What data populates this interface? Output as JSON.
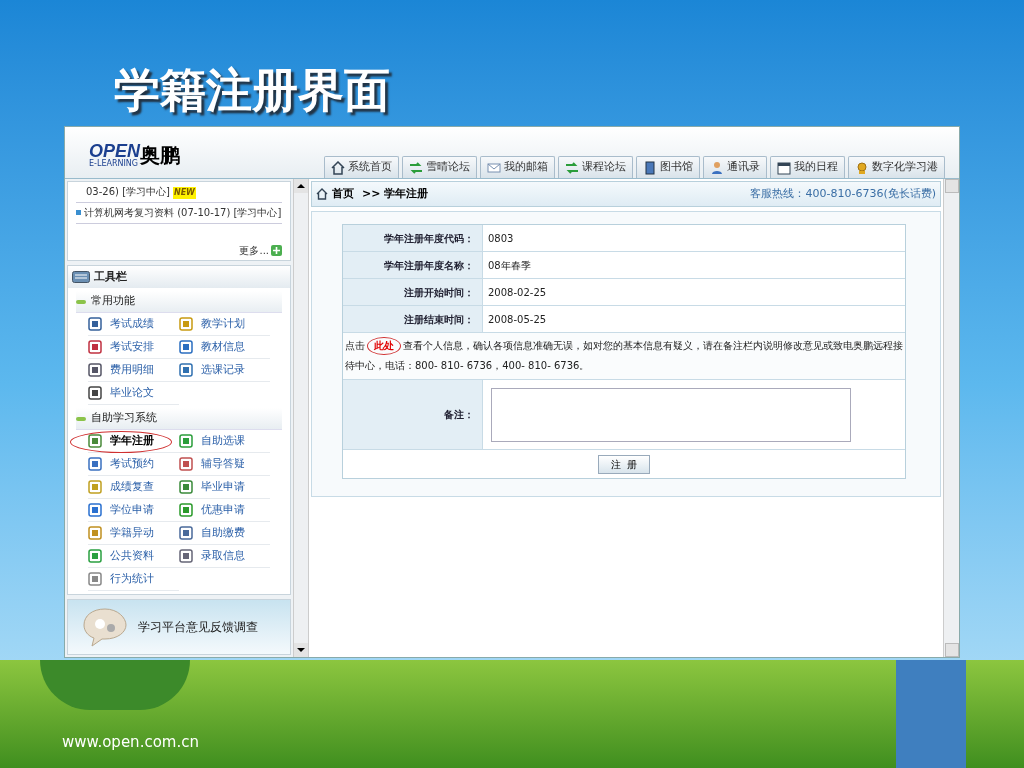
{
  "slide": {
    "title": "学籍注册界面",
    "footer": "www.open.com.cn"
  },
  "window": {
    "logo": {
      "brand": "OPEN",
      "brand_cn": "奥鹏",
      "tagline": "E-LEARNING"
    },
    "tabs": [
      {
        "label": "系统首页",
        "selected": false
      },
      {
        "label": "雪晴论坛",
        "selected": false
      },
      {
        "label": "我的邮箱",
        "selected": false
      },
      {
        "label": "课程论坛",
        "selected": false
      },
      {
        "label": "图书馆",
        "selected": false
      },
      {
        "label": "通讯录",
        "selected": false
      },
      {
        "label": "我的日程",
        "selected": false
      },
      {
        "label": "数字化学习港",
        "selected": false
      }
    ]
  },
  "news": {
    "items": [
      {
        "text": "03-26) [学习中心]",
        "badge": "NEW",
        "bullet": false
      },
      {
        "text": "计算机网考复习资料  (07-10-17) [学习中心]",
        "bullet": true
      }
    ],
    "more": "更多..."
  },
  "toolbar": {
    "title": "工具栏",
    "sections": [
      {
        "title": "常用功能",
        "items": [
          {
            "label": "考试成绩",
            "circled": false
          },
          {
            "label": "教学计划",
            "circled": false
          },
          {
            "label": "考试安排",
            "circled": false
          },
          {
            "label": "教材信息",
            "circled": false
          },
          {
            "label": "费用明细",
            "circled": false
          },
          {
            "label": "选课记录",
            "circled": false
          },
          {
            "label": "毕业论文",
            "circled": false
          }
        ]
      },
      {
        "title": "自助学习系统",
        "items": [
          {
            "label": "学年注册",
            "circled": true
          },
          {
            "label": "自助选课",
            "circled": false
          },
          {
            "label": "考试预约",
            "circled": false
          },
          {
            "label": "辅导答疑",
            "circled": false
          },
          {
            "label": "成绩复查",
            "circled": false
          },
          {
            "label": "毕业申请",
            "circled": false
          },
          {
            "label": "学位申请",
            "circled": false
          },
          {
            "label": "优惠申请",
            "circled": false
          },
          {
            "label": "学籍异动",
            "circled": false
          },
          {
            "label": "自助缴费",
            "circled": false
          },
          {
            "label": "公共资料",
            "circled": false
          },
          {
            "label": "录取信息",
            "circled": false
          },
          {
            "label": "行为统计",
            "circled": false
          }
        ]
      }
    ]
  },
  "feedback": "学习平台意见反馈调查",
  "breadcrumb": {
    "home": "首页",
    "current": ">> 学年注册",
    "hotline": "客服热线：400-810-6736(免长话费)"
  },
  "form": {
    "fields": [
      {
        "label": "学年注册年度代码：",
        "value": "0803"
      },
      {
        "label": "学年注册年度名称：",
        "value": "08年春季"
      },
      {
        "label": "注册开始时间：",
        "value": "2008-02-25"
      },
      {
        "label": "注册结束时间：",
        "value": "2008-05-25"
      }
    ],
    "notice": {
      "before": "点击",
      "link": "此处",
      "after": "查看个人信息，确认各项信息准确无误，如对您的基本信息有疑义，请在备注栏内说明修改意见或致电奥鹏远程接待中心，电话：800- 810- 6736，400- 810- 6736。",
      "link_circled": true
    },
    "remark_label": "备注：",
    "button": "注  册"
  }
}
